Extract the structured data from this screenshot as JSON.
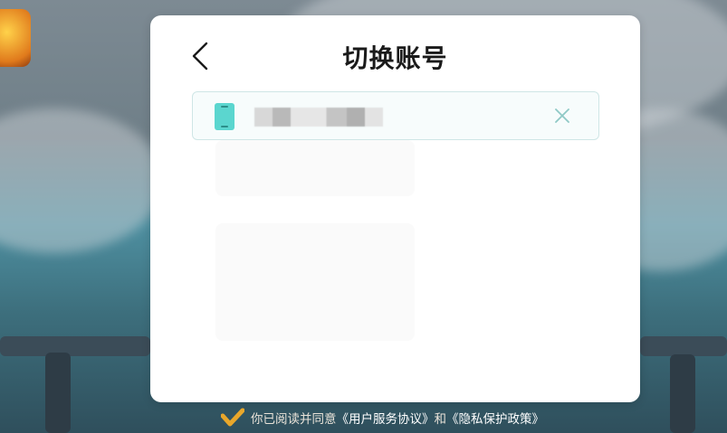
{
  "dialog": {
    "title": "切换账号",
    "back_icon": "chevron-left-icon"
  },
  "account": {
    "phone_icon": "phone-icon",
    "phone_value_redacted": true,
    "clear_icon": "close-icon"
  },
  "agreement": {
    "check_icon": "check-icon",
    "prefix": "你已阅读并同意",
    "user_agreement": "《用户服务协议》",
    "conjunction": "和",
    "privacy_policy": "《隐私保护政策》"
  },
  "colors": {
    "accent": "#5bd6cf",
    "modal_bg": "#ffffff",
    "row_border": "#cfe6e6",
    "check": "#e9a72b"
  }
}
